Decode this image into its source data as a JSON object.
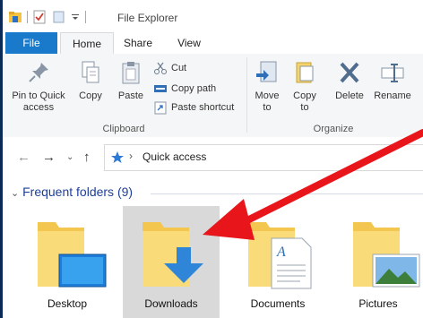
{
  "window": {
    "title": "File Explorer"
  },
  "tabs": [
    {
      "label": "File"
    },
    {
      "label": "Home"
    },
    {
      "label": "Share"
    },
    {
      "label": "View"
    }
  ],
  "ribbon": {
    "clipboard": {
      "pin_label": "Pin to Quick access",
      "copy_label": "Copy",
      "paste_label": "Paste",
      "cut_label": "Cut",
      "copy_path_label": "Copy path",
      "paste_shortcut_label": "Paste shortcut",
      "group_label": "Clipboard"
    },
    "organize": {
      "move_to_label": "Move to",
      "copy_to_label": "Copy to",
      "delete_label": "Delete",
      "rename_label": "Rename",
      "group_label": "Organize"
    }
  },
  "address": {
    "location": "Quick access"
  },
  "section": {
    "title": "Frequent folders (9)"
  },
  "folders": [
    {
      "name": "Desktop"
    },
    {
      "name": "Downloads"
    },
    {
      "name": "Documents"
    },
    {
      "name": "Pictures"
    }
  ],
  "colors": {
    "file_tab": "#1979ca",
    "annotation_arrow": "#e8161b",
    "folder_yellow": "#f7d26b",
    "accent_blue": "#1e88e5"
  }
}
